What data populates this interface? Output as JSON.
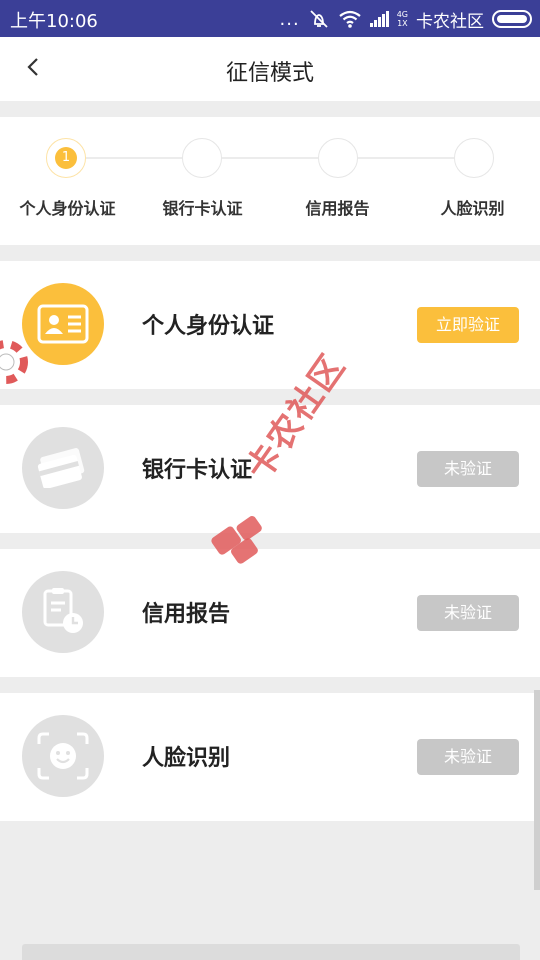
{
  "status_bar": {
    "time": "上午10:06",
    "dots": "...",
    "network": "4G\n1X",
    "carrier": "卡农社区"
  },
  "header": {
    "title": "征信模式"
  },
  "steps": [
    {
      "number": "1",
      "label": "个人身份认证",
      "active": true
    },
    {
      "number": "",
      "label": "银行卡认证",
      "active": false
    },
    {
      "number": "",
      "label": "信用报告",
      "active": false
    },
    {
      "number": "",
      "label": "人脸识别",
      "active": false
    }
  ],
  "cards": [
    {
      "title": "个人身份认证",
      "button": "立即验证",
      "status": "active",
      "icon": "id-card-icon",
      "color": "#fbbf3c"
    },
    {
      "title": "银行卡认证",
      "button": "未验证",
      "status": "pending",
      "icon": "bank-card-icon",
      "color": "#e0e0e0"
    },
    {
      "title": "信用报告",
      "button": "未验证",
      "status": "pending",
      "icon": "credit-report-icon",
      "color": "#e0e0e0"
    },
    {
      "title": "人脸识别",
      "button": "未验证",
      "status": "pending",
      "icon": "face-scan-icon",
      "color": "#e0e0e0"
    }
  ],
  "watermark": {
    "text": "卡农社区"
  },
  "colors": {
    "status_bar": "#3b3f97",
    "accent": "#fbbf3c",
    "disabled": "#c7c7c7"
  }
}
